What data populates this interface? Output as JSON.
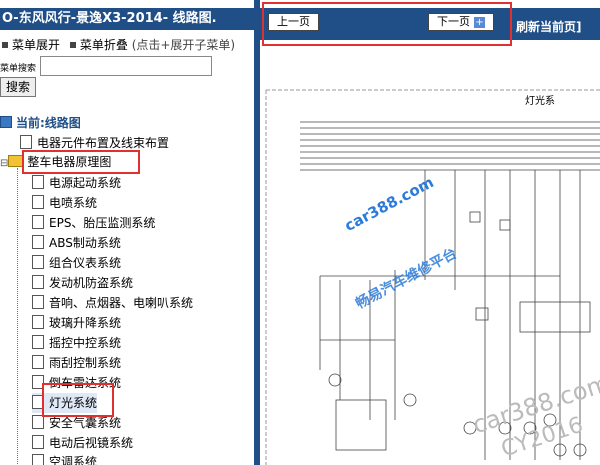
{
  "left": {
    "title": "O-东风风行-景逸X3-2014- 线路图.",
    "menu": {
      "expand": "菜单展开",
      "collapse": "菜单折叠",
      "hint": "(点击+展开子菜单)"
    },
    "search": {
      "label": "菜单搜索",
      "button": "搜索"
    },
    "tree": {
      "root": "当前:线路图",
      "items": [
        "电器元件布置及线束布置",
        "整车电器原理图",
        "电源起动系统",
        "电喷系统",
        "EPS、胎压监测系统",
        "ABS制动系统",
        "组合仪表系统",
        "发动机防盗系统",
        "音响、点烟器、电喇叭系统",
        "玻璃升降系统",
        "摇控中控系统",
        "雨刮控制系统",
        "倒车雷达系统",
        "灯光系统",
        "安全气囊系统",
        "电动后视镜系统",
        "空调系统"
      ]
    }
  },
  "right": {
    "prev": "上一页",
    "next": "下一页",
    "refresh": "刷新当前页]",
    "diagram_title": "灯光系",
    "watermarks": [
      "car388.com",
      "畅易汽车维修平台",
      "car388.com",
      "CY2016"
    ]
  },
  "colors": {
    "titlebar": "#1f4f86",
    "highlight": "#e03030",
    "watermark": "#2c7bd8"
  }
}
